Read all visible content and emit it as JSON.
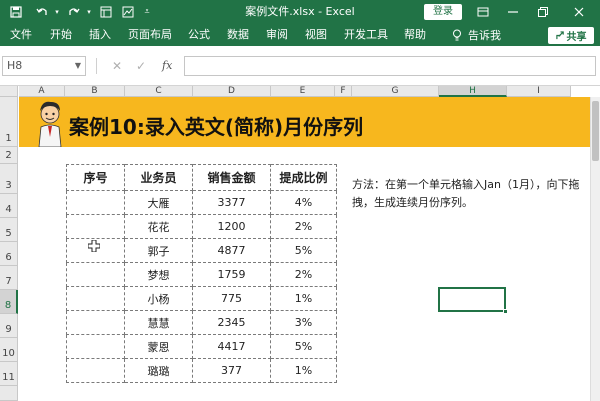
{
  "window": {
    "title": "案例文件.xlsx  -  Excel",
    "login_label": "登录"
  },
  "ribbon": {
    "tabs": [
      "文件",
      "开始",
      "插入",
      "页面布局",
      "公式",
      "数据",
      "审阅",
      "视图",
      "开发工具",
      "帮助"
    ],
    "tell_me": "告诉我",
    "share_label": "共享"
  },
  "formula_bar": {
    "name_box": "H8",
    "fx_label": "fx",
    "content": ""
  },
  "columns": [
    "A",
    "B",
    "C",
    "D",
    "E",
    "F",
    "G",
    "H",
    "I"
  ],
  "rows": [
    "1",
    "2",
    "3",
    "4",
    "5",
    "6",
    "7",
    "8",
    "9",
    "10",
    "11"
  ],
  "active_cell": {
    "column": "H",
    "row": "8"
  },
  "sheet": {
    "banner_title": "案例10:录入英文(简称)月份序列",
    "table": {
      "headers": [
        "序号",
        "业务员",
        "销售金额",
        "提成比例"
      ],
      "rows": [
        [
          "",
          "大雁",
          "3377",
          "4%"
        ],
        [
          "",
          "花花",
          "1200",
          "2%"
        ],
        [
          "",
          "郭子",
          "4877",
          "5%"
        ],
        [
          "",
          "梦想",
          "1759",
          "2%"
        ],
        [
          "",
          "小杨",
          "775",
          "1%"
        ],
        [
          "",
          "慧慧",
          "2345",
          "3%"
        ],
        [
          "",
          "蒙恩",
          "4417",
          "5%"
        ],
        [
          "",
          "璐璐",
          "377",
          "1%"
        ]
      ]
    },
    "method_text": "方法：在第一个单元格输入Jan（1月），向下拖拽，生成连续月份序列。"
  },
  "colors": {
    "excel_green": "#217346",
    "banner_yellow": "#f7b71e"
  }
}
